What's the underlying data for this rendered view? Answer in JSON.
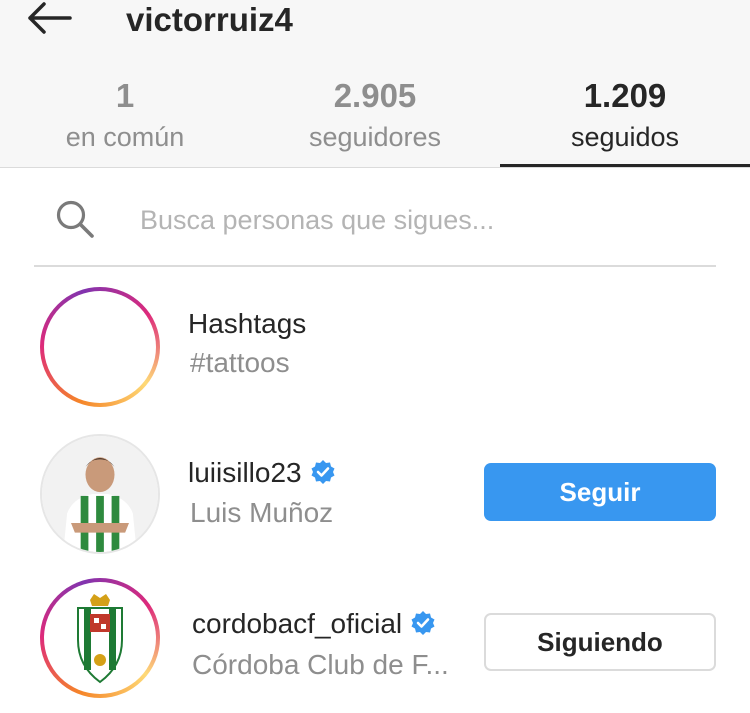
{
  "header": {
    "username": "victorruiz4",
    "stats": [
      {
        "value": "1",
        "label": "en común"
      },
      {
        "value": "2.905",
        "label": "seguidores"
      },
      {
        "value": "1.209",
        "label": "seguidos",
        "active": true
      }
    ]
  },
  "search": {
    "value": "",
    "placeholder": "Busca personas que sigues..."
  },
  "list": [
    {
      "title": "Hashtags",
      "subtitle": "#tattoos",
      "avatar_icon": "hashtag-icon"
    },
    {
      "username": "luiisillo23",
      "full_name": "Luis Muñoz",
      "verified": true,
      "button": "Seguir",
      "avatar_icon": "player-photo"
    },
    {
      "username": "cordobacf_oficial",
      "full_name": "Córdoba Club de F...",
      "verified": true,
      "button": "Siguiendo",
      "avatar_icon": "club-crest"
    }
  ],
  "colors": {
    "accent_blue": "#3897f0",
    "text_primary": "#262626",
    "text_secondary": "#8e8e8e",
    "verified_blue": "#3897f0"
  }
}
